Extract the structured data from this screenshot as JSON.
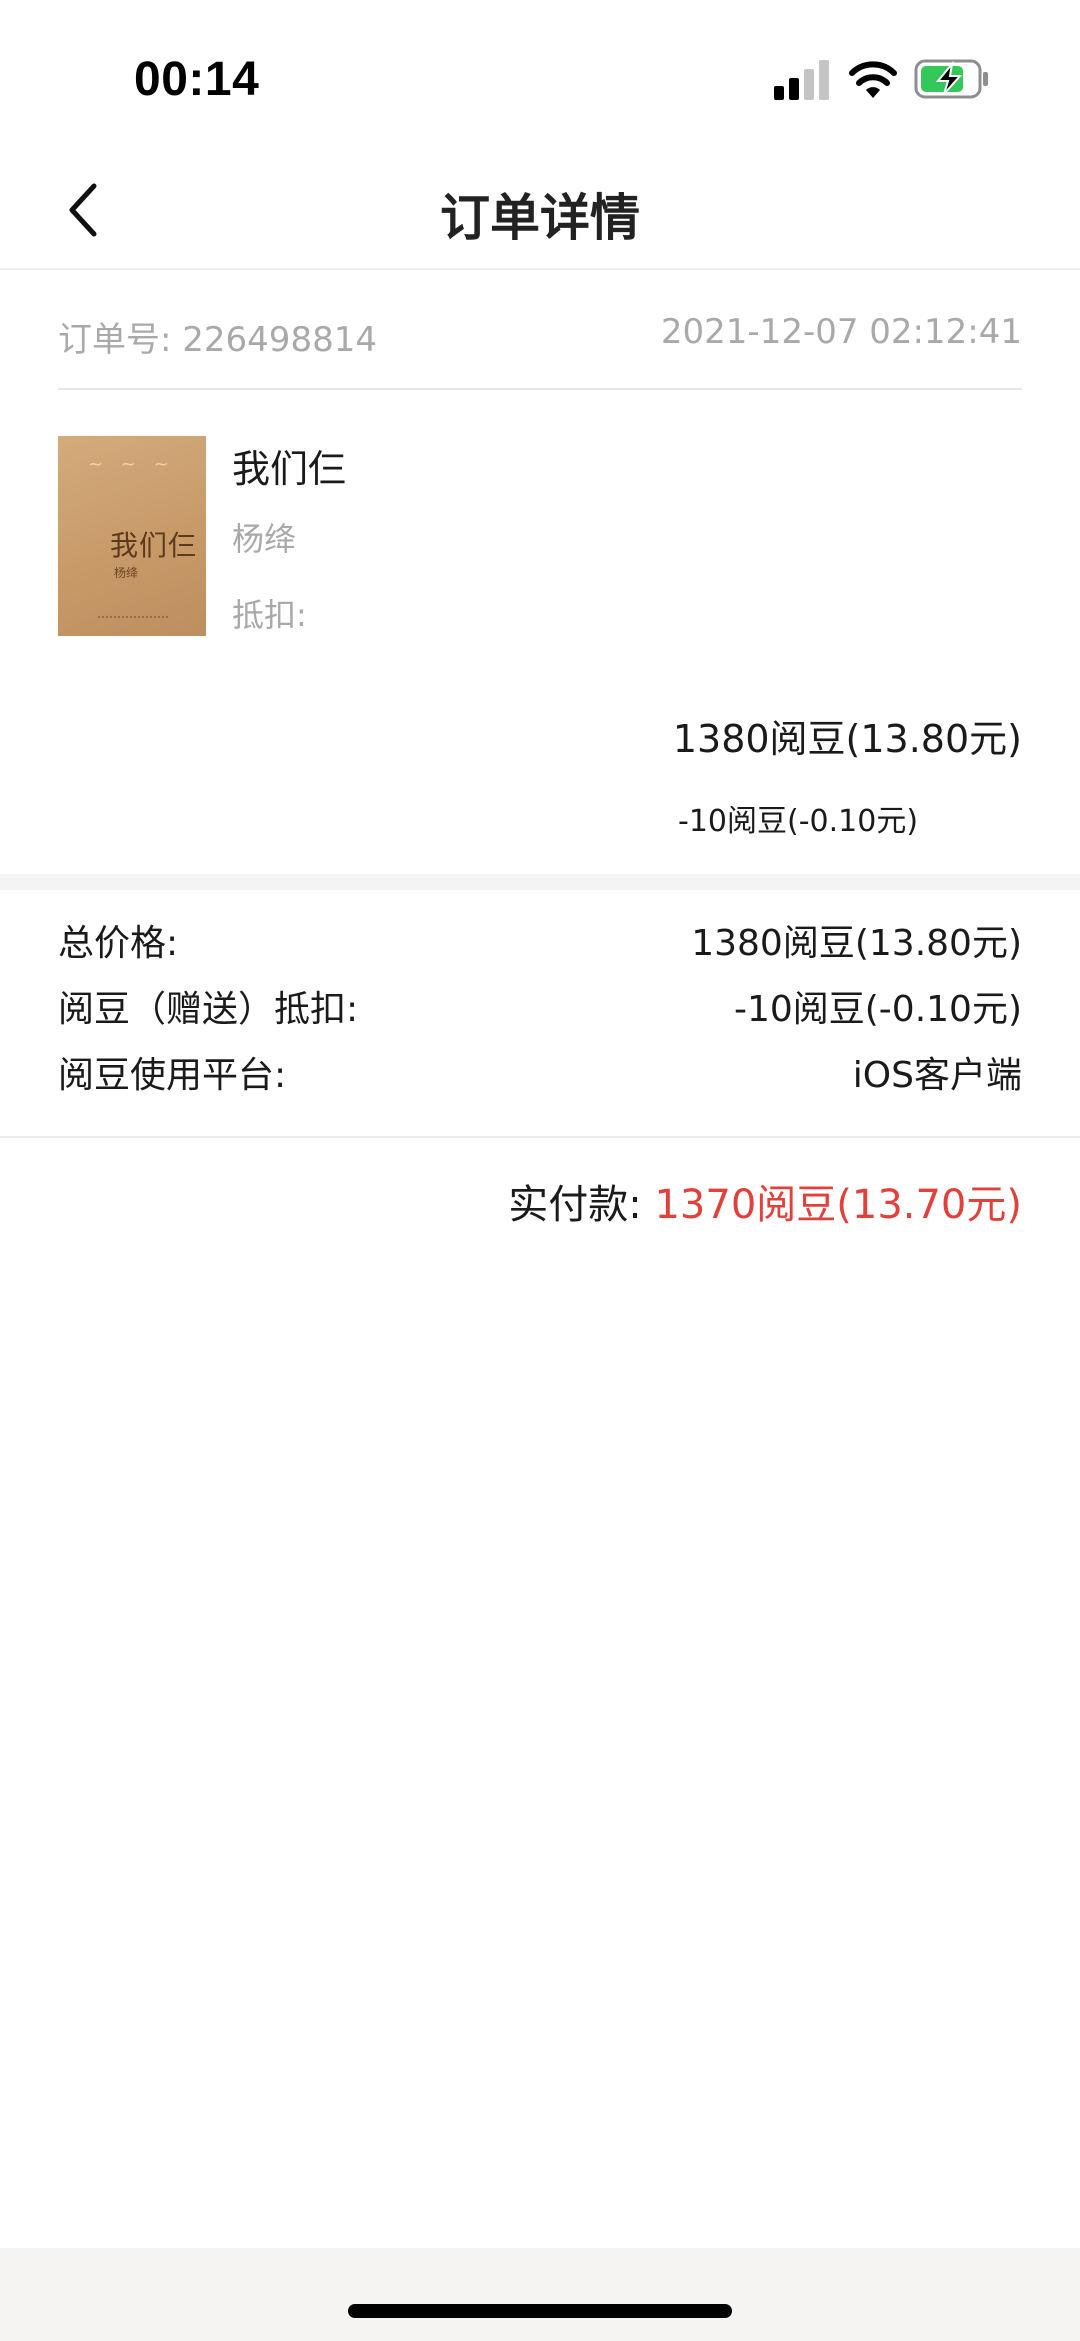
{
  "status_bar": {
    "time": "00:14",
    "icons": [
      "signal-icon",
      "wifi-icon",
      "battery-charging-icon"
    ],
    "battery_color": "#34c759"
  },
  "nav": {
    "title": "订单详情",
    "back_icon": "chevron-left-icon"
  },
  "order": {
    "order_no_label": "订单号:",
    "order_no": "226498814",
    "time": "2021-12-07 02:12:41"
  },
  "book": {
    "cover_title": "我们仨",
    "cover_author": "杨绛",
    "title": "我们仨",
    "author": "杨绛",
    "deduct_label": "抵扣:",
    "price": "1380阅豆(13.80元)",
    "discount": "-10阅豆(-0.10元)"
  },
  "summary": {
    "rows": [
      {
        "label": "总价格:",
        "value": "1380阅豆(13.80元)"
      },
      {
        "label": "阅豆（赠送）抵扣:",
        "value": "-10阅豆(-0.10元)"
      },
      {
        "label": "阅豆使用平台:",
        "value": "iOS客户端"
      }
    ]
  },
  "paid": {
    "label": "实付款: ",
    "value": "1370阅豆(13.70元)",
    "color": "#e0413a"
  }
}
